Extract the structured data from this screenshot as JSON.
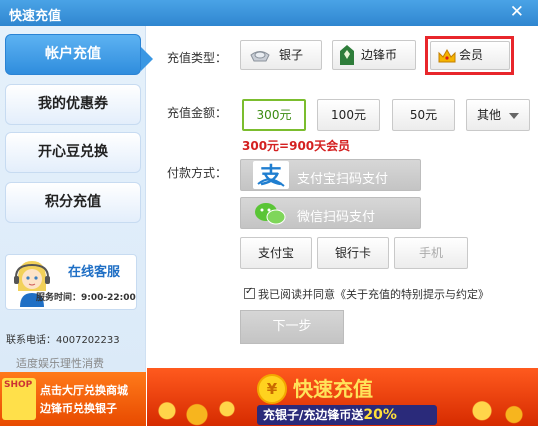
{
  "window": {
    "title": "快速充值",
    "close_glyph": "✕"
  },
  "sidebar": {
    "items": [
      {
        "label": "帐户充值",
        "active": true
      },
      {
        "label": "我的优惠券",
        "active": false
      },
      {
        "label": "开心豆兑换",
        "active": false
      },
      {
        "label": "积分充值",
        "active": false
      }
    ],
    "support": {
      "title": "在线客服",
      "hours": "服务时间：9:00-22:00"
    },
    "phone": "联系电话：4007202233",
    "slogan": "适度娱乐理性消费",
    "shop_banner": {
      "icon_text": "SHOP",
      "line1": "点击大厅兑换商城",
      "line2": "边锋币兑换银子"
    }
  },
  "recharge": {
    "type_label": "充值类型：",
    "types": [
      {
        "label": "银子",
        "icon": "silver-ingot-icon"
      },
      {
        "label": "边锋币",
        "icon": "bianfeng-coin-icon"
      },
      {
        "label": "会员",
        "icon": "crown-icon",
        "selected": true
      }
    ],
    "amount_label": "充值金额：",
    "amounts": [
      "300元",
      "100元",
      "50元",
      "其他"
    ],
    "selected_amount": "300元",
    "note": "300元=900天会员",
    "payment_label": "付款方式：",
    "payments": {
      "alipay_scan": "支付宝扫码支付",
      "wechat_scan": "微信扫码支付",
      "alipay": "支付宝",
      "bank_card": "银行卡",
      "mobile": "手机"
    },
    "agreement": "我已阅读并同意《关于充值的特别提示与约定》",
    "agreement_checked": true,
    "next_button": "下一步"
  },
  "promo": {
    "coin_glyph": "¥",
    "title": "快速充值",
    "subtitle": "充银子/充边锋币送",
    "bonus": "20%"
  },
  "colors": {
    "accent": "#2f8ddd",
    "highlight": "#e8262b",
    "selected": "#7bbd2e",
    "price_note": "#d42020"
  }
}
